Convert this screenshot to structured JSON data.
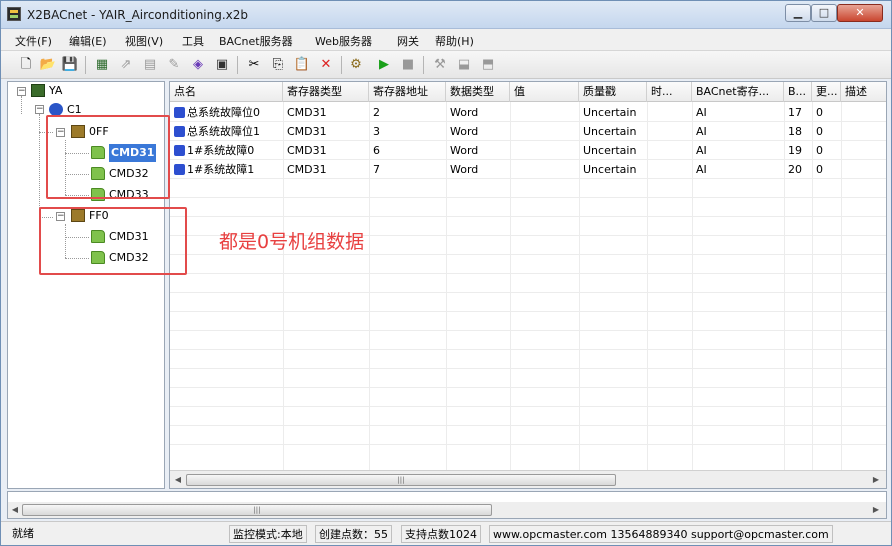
{
  "window": {
    "title": "X2BACnet - YAIR_Airconditioning.x2b"
  },
  "menu": [
    "文件(F)",
    "编辑(E)",
    "视图(V)",
    "工具",
    "BACnet服务器",
    "Web服务器",
    "网关",
    "帮助(H)"
  ],
  "tree": {
    "root": "YA",
    "channel": "C1",
    "devices": [
      {
        "name": "0FF",
        "items": [
          "CMD31",
          "CMD32",
          "CMD33"
        ]
      },
      {
        "name": "FF0",
        "items": [
          "CMD31",
          "CMD32"
        ]
      }
    ]
  },
  "annotation": "都是0号机组数据",
  "table": {
    "headers": [
      "点名",
      "寄存器类型",
      "寄存器地址",
      "数据类型",
      "值",
      "质量戳",
      "时...",
      "BACnet寄存...",
      "B...",
      "更...",
      "描述"
    ],
    "rows": [
      [
        "总系统故障位0",
        "CMD31",
        "2",
        "Word",
        "",
        "Uncertain",
        "",
        "AI",
        "17",
        "0",
        ""
      ],
      [
        "总系统故障位1",
        "CMD31",
        "3",
        "Word",
        "",
        "Uncertain",
        "",
        "AI",
        "18",
        "0",
        ""
      ],
      [
        "1#系统故障0",
        "CMD31",
        "6",
        "Word",
        "",
        "Uncertain",
        "",
        "AI",
        "19",
        "0",
        ""
      ],
      [
        "1#系统故障1",
        "CMD31",
        "7",
        "Word",
        "",
        "Uncertain",
        "",
        "AI",
        "20",
        "0",
        ""
      ]
    ]
  },
  "status": {
    "ready": "就绪",
    "mode": "监控模式:本地",
    "created": "创建点数：55",
    "supported": "支持点数1024",
    "contact": "www.opcmaster.com 13564889340 support@opcmaster.com"
  },
  "colors": {
    "highlight_box": "#e24b4b",
    "annotation": "#e84040",
    "selection": "#3a78d8"
  }
}
